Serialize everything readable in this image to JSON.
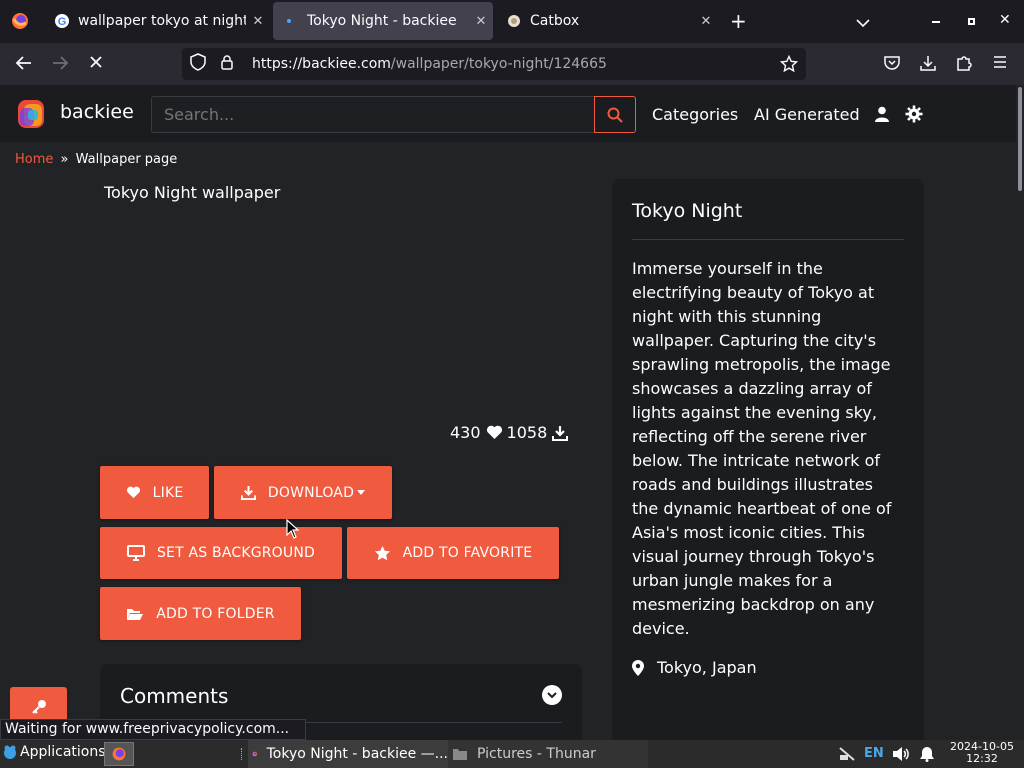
{
  "browser": {
    "tabs": [
      {
        "title": "wallpaper tokyo at night",
        "favicon": "google-icon"
      },
      {
        "title": "Tokyo Night - backiee",
        "favicon": "backiee-icon",
        "active": true
      },
      {
        "title": "Catbox",
        "favicon": "catbox-icon"
      }
    ],
    "new_tab": "+",
    "url_host": "https://backiee.com",
    "url_path": "/wallpaper/tokyo-night/124665",
    "status_text": "Waiting for www.freeprivacypolicy.com..."
  },
  "site": {
    "logo_text": "backiee",
    "search_placeholder": "Search...",
    "nav": {
      "categories": "Categories",
      "ai_generated": "AI Generated"
    },
    "breadcrumb": {
      "home": "Home",
      "sep": "»",
      "current": "Wallpaper page"
    }
  },
  "wallpaper": {
    "title": "Tokyo Night wallpaper",
    "likes": "430",
    "downloads": "1058"
  },
  "buttons": {
    "like": "LIKE",
    "download": "DOWNLOAD",
    "set_background": "SET AS BACKGROUND",
    "add_favorite": "ADD TO FAVORITE",
    "add_folder": "ADD TO FOLDER"
  },
  "comments": {
    "title": "Comments"
  },
  "sidebar": {
    "title": "Tokyo Night",
    "description": "Immerse yourself in the electrifying beauty of Tokyo at night with this stunning wallpaper. Capturing the city's sprawling metropolis, the image showcases a dazzling array of lights against the evening sky, reflecting off the serene river below. The intricate network of roads and buildings illustrates the dynamic heartbeat of one of Asia's most iconic cities. This visual journey through Tokyo's urban jungle makes for a mesmerizing backdrop on any device.",
    "location": "Tokyo, Japan"
  },
  "taskbar": {
    "applications": "Applications",
    "window1": "Tokyo Night - backiee —...",
    "window2": "Pictures - Thunar",
    "lang": "EN",
    "date": "2024-10-05",
    "time": "12:32"
  },
  "colors": {
    "accent": "#f05a3e",
    "page_bg": "#222326",
    "card_bg": "#1b1c1f"
  }
}
